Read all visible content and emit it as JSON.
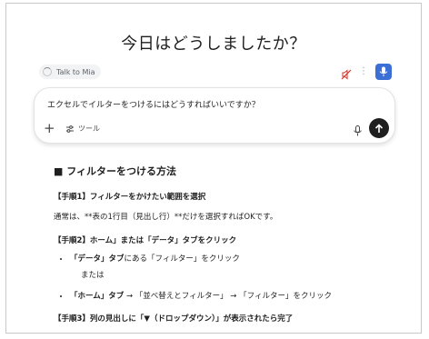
{
  "page": {
    "title": "今日はどうしましたか？"
  },
  "assistant": {
    "talk_label": "Talk to Mia",
    "more_label": "⋮"
  },
  "composer": {
    "input_value": "エクセルでイルターをつけるにはどうすればいいですか？",
    "plus_label": "+",
    "tools_label": "ツール"
  },
  "answer": {
    "heading": "■ フィルターをつける方法",
    "step1": "【手順1】フィルターをかけたい範囲を選択",
    "step1_body": "通常は、**表の1行目（見出し行）**だけを選択すればOKです。",
    "step2": "【手順2】ホーム」または「データ」タブをクリック",
    "step2_item1_bold": "「データ」タブ",
    "step2_item1_rest": "にある「フィルター」をクリック",
    "step2_or": "または",
    "step2_item2_bold": "「ホーム」タブ",
    "step2_item2_rest": " → 「並べ替えとフィルター」 → 「フィルター」をクリック",
    "step3": "【手順3】列の見出しに「▼（ドロップダウン）」が表示されたら完了"
  },
  "colors": {
    "mic_button": "#3b6fd6",
    "send_button": "#1f1f1f",
    "mute_icon": "#d93025"
  }
}
